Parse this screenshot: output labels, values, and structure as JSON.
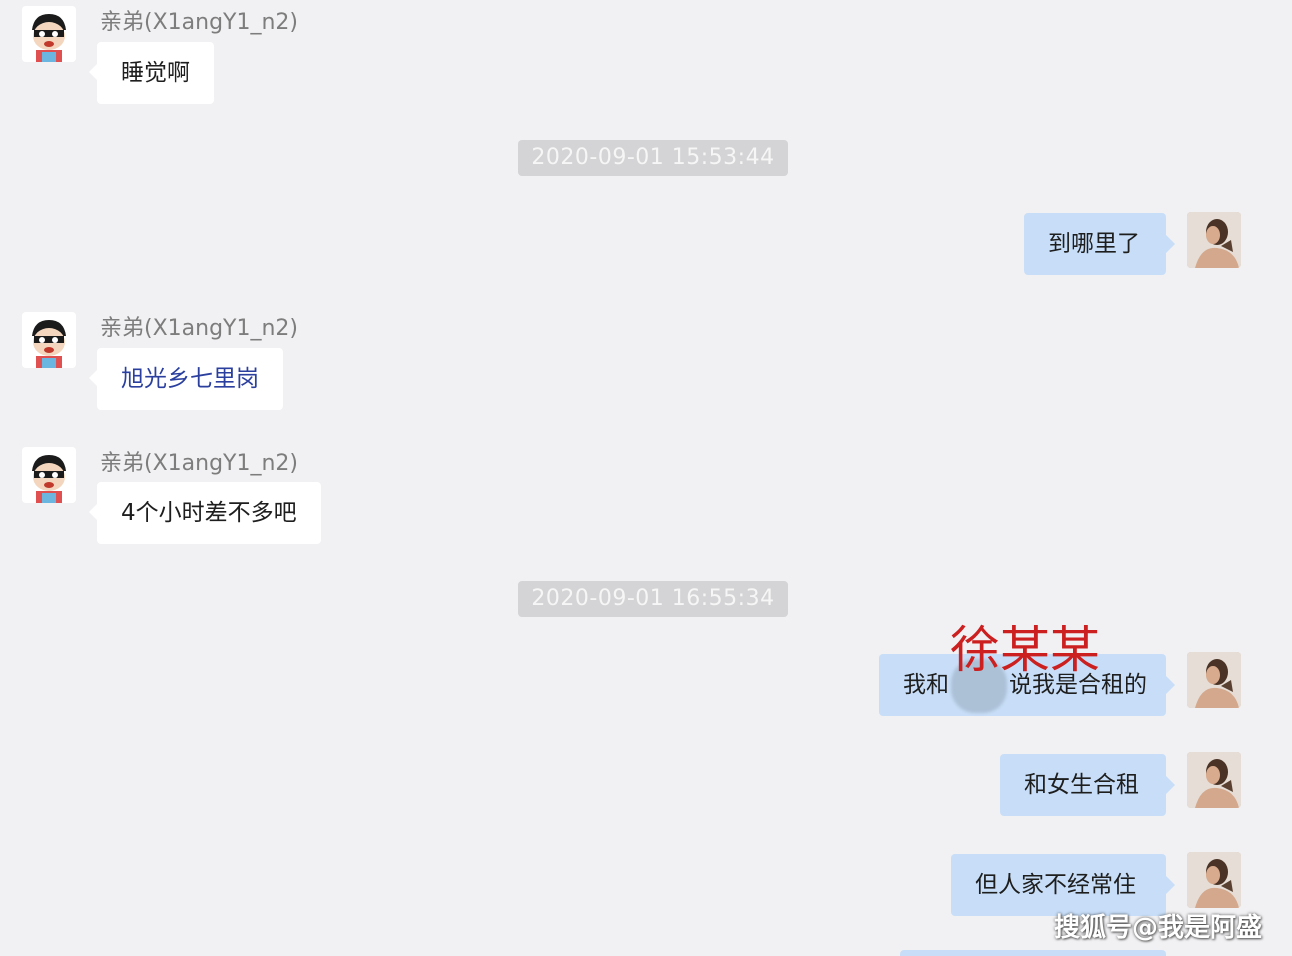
{
  "sender_name": "亲弟(X1angY1_n2)",
  "messages": [
    {
      "type": "text",
      "from": "friend",
      "text": "睡觉啊"
    },
    {
      "type": "timestamp",
      "text": "2020-09-01 15:53:44"
    },
    {
      "type": "text",
      "from": "me",
      "text": "到哪里了"
    },
    {
      "type": "text",
      "from": "friend",
      "text": "旭光乡七里岗"
    },
    {
      "type": "text",
      "from": "friend",
      "text": "4个小时差不多吧"
    },
    {
      "type": "timestamp",
      "text": "2020-09-01 16:55:34"
    },
    {
      "type": "text",
      "from": "me",
      "text_before": "我和",
      "text_after": "说我是合租的"
    },
    {
      "type": "text",
      "from": "me",
      "text": "和女生合租"
    },
    {
      "type": "text",
      "from": "me",
      "text": "但人家不经常住"
    }
  ],
  "annotation": "徐某某",
  "watermark": "搜狐号@我是阿盛",
  "colors": {
    "background": "#f1f1f3",
    "incoming_bubble": "#ffffff",
    "outgoing_bubble": "#c8def8",
    "link_text": "#2a3f9e",
    "annotation": "#cc1f1f"
  }
}
